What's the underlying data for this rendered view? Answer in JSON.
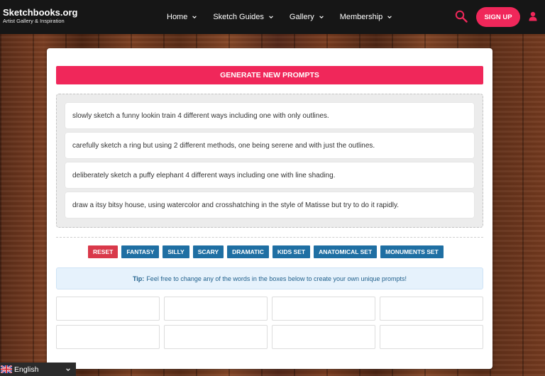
{
  "header": {
    "title": "Sketchbooks.org",
    "subtitle": "Artist Gallery & Inspiration",
    "nav": [
      {
        "label": "Home",
        "icon": "chevron-down-icon"
      },
      {
        "label": "Sketch Guides",
        "icon": "chevron-down-icon"
      },
      {
        "label": "Gallery",
        "icon": "chevron-down-icon"
      },
      {
        "label": "Membership",
        "icon": "chevron-down-icon"
      }
    ],
    "search_icon": "search-icon",
    "signup_label": "SIGN UP",
    "user_icon": "user-icon"
  },
  "main": {
    "generate_label": "GENERATE NEW PROMPTS",
    "prompts": [
      "slowly sketch a funny lookin train 4 different ways including one with only outlines.",
      "carefully sketch a ring but using 2 different methods, one being serene and with just the outlines.",
      "deliberately sketch a puffy elephant 4 different ways including one with line shading.",
      "draw a itsy bitsy house, using watercolor and crosshatching in the style of Matisse but try to do it rapidly."
    ],
    "tags": [
      "RESET",
      "FANTASY",
      "SILLY",
      "SCARY",
      "DRAMATIC",
      "KIDS SET",
      "ANATOMICAL SET",
      "MONUMENTS SET"
    ],
    "tip_label": "Tip:",
    "tip_text": "Feel free to change any of the words in the boxes below to create your own unique prompts!",
    "inputs": [
      "",
      "",
      "",
      "",
      "",
      "",
      "",
      ""
    ]
  },
  "language": {
    "label": "English",
    "flag_icon": "uk-flag-icon"
  },
  "colors": {
    "accent": "#f0275a",
    "tag_blue": "#1f6fa3",
    "tag_red": "#d9394a",
    "header_bg": "#161616"
  }
}
